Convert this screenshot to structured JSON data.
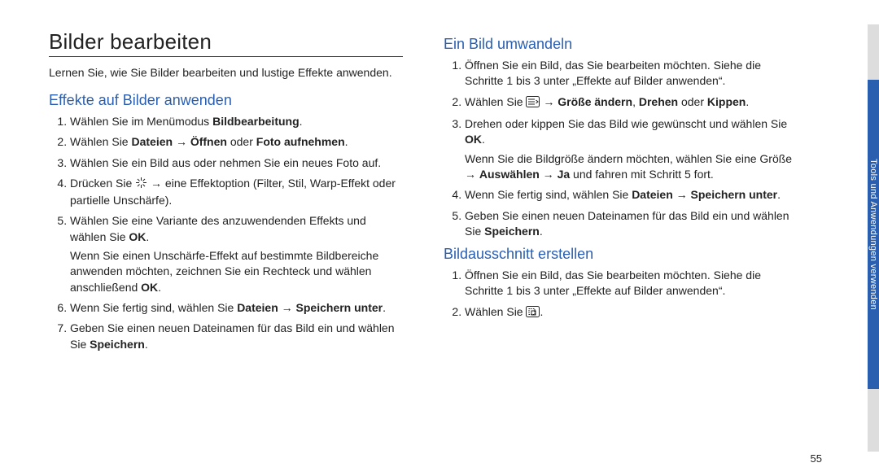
{
  "page_number": "55",
  "side_tab": "Tools und Anwendungen verwenden",
  "left": {
    "title": "Bilder bearbeiten",
    "intro": "Lernen Sie, wie Sie Bilder bearbeiten und lustige Effekte anwenden.",
    "section1_title": "Effekte auf Bilder anwenden",
    "s1_li1_a": "Wählen Sie im Menümodus ",
    "s1_li1_b": "Bildbearbeitung",
    "s1_li1_c": ".",
    "s1_li2_a": "Wählen Sie ",
    "s1_li2_b": "Dateien",
    "s1_li2_c": " → ",
    "s1_li2_d": "Öffnen",
    "s1_li2_e": " oder ",
    "s1_li2_f": "Foto aufnehmen",
    "s1_li2_g": ".",
    "s1_li3": "Wählen Sie ein Bild aus oder nehmen Sie ein neues Foto auf.",
    "s1_li4_a": "Drücken Sie ",
    "s1_li4_b": " → eine Effektoption (Filter, Stil, Warp-Effekt oder partielle Unschärfe).",
    "s1_li5_a": "Wählen Sie eine Variante des anzuwendenden Effekts und wählen Sie ",
    "s1_li5_b": "OK",
    "s1_li5_c": ".",
    "s1_li5_sub_a": "Wenn Sie einen Unschärfe-Effekt auf bestimmte Bildbereiche anwenden möchten, zeichnen Sie ein Rechteck und wählen anschließend ",
    "s1_li5_sub_b": "OK",
    "s1_li5_sub_c": ".",
    "s1_li6_a": "Wenn Sie fertig sind, wählen Sie ",
    "s1_li6_b": "Dateien",
    "s1_li6_c": " → ",
    "s1_li6_d": "Speichern unter",
    "s1_li6_e": ".",
    "s1_li7_a": "Geben Sie einen neuen Dateinamen für das Bild ein und wählen Sie ",
    "s1_li7_b": "Speichern",
    "s1_li7_c": "."
  },
  "right": {
    "section2_title": "Ein Bild umwandeln",
    "s2_li1": "Öffnen Sie ein Bild, das Sie bearbeiten möchten. Siehe die Schritte 1 bis 3 unter „Effekte auf Bilder anwenden“.",
    "s2_li2_a": "Wählen Sie ",
    "s2_li2_b": " → ",
    "s2_li2_c": "Größe ändern",
    "s2_li2_d": ", ",
    "s2_li2_e": "Drehen",
    "s2_li2_f": " oder ",
    "s2_li2_g": "Kippen",
    "s2_li2_h": ".",
    "s2_li3_a": "Drehen oder kippen Sie das Bild wie gewünscht und wählen Sie ",
    "s2_li3_b": "OK",
    "s2_li3_c": ".",
    "s2_li3_sub_a": "Wenn Sie die Bildgröße ändern möchten, wählen Sie eine Größe → ",
    "s2_li3_sub_b": "Auswählen",
    "s2_li3_sub_c": " → ",
    "s2_li3_sub_d": "Ja",
    "s2_li3_sub_e": " und fahren mit Schritt 5 fort.",
    "s2_li4_a": "Wenn Sie fertig sind, wählen Sie ",
    "s2_li4_b": "Dateien",
    "s2_li4_c": " → ",
    "s2_li4_d": "Speichern unter",
    "s2_li4_e": ".",
    "s2_li5_a": "Geben Sie einen neuen Dateinamen für das Bild ein und wählen Sie ",
    "s2_li5_b": "Speichern",
    "s2_li5_c": ".",
    "section3_title": "Bildausschnitt erstellen",
    "s3_li1": "Öffnen Sie ein Bild, das Sie bearbeiten möchten. Siehe die Schritte 1 bis 3 unter „Effekte auf Bilder anwenden“.",
    "s3_li2_a": "Wählen Sie ",
    "s3_li2_b": "."
  }
}
